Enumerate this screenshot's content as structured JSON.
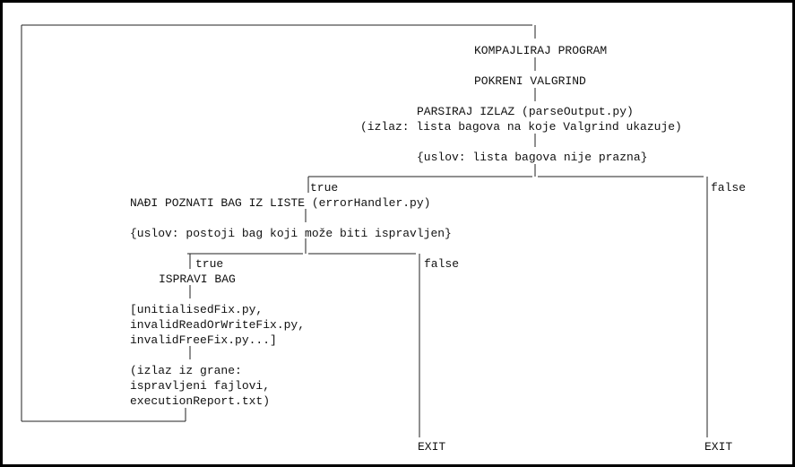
{
  "steps": {
    "compile": "KOMPAJLIRAJ PROGRAM",
    "run_valgrind": "POKRENI VALGRIND",
    "parse_output": "PARSIRAJ IZLAZ (parseOutput.py)",
    "parse_output_note": "(izlaz: lista bagova na koje Valgrind ukazuje)",
    "outer_condition": "{uslov: lista bagova nije prazna}",
    "find_bug": "NAĐI POZNATI BAG IZ LISTE (errorHandler.py)",
    "inner_condition": "{uslov: postoji bag koji može biti ispravljen}",
    "fix_bug": "ISPRAVI BAG",
    "fix_scripts": [
      "[unitialisedFix.py,",
      "invalidReadOrWriteFix.py,",
      "invalidFreeFix.py...]"
    ],
    "branch_output": [
      "(izlaz iz grane:",
      "ispravljeni fajlovi,",
      "executionReport.txt)"
    ]
  },
  "branches": {
    "outer_true": "true",
    "outer_false": "false",
    "inner_true": "true",
    "inner_false": "false"
  },
  "exits": {
    "inner_false_exit": "EXIT",
    "outer_false_exit": "EXIT"
  }
}
